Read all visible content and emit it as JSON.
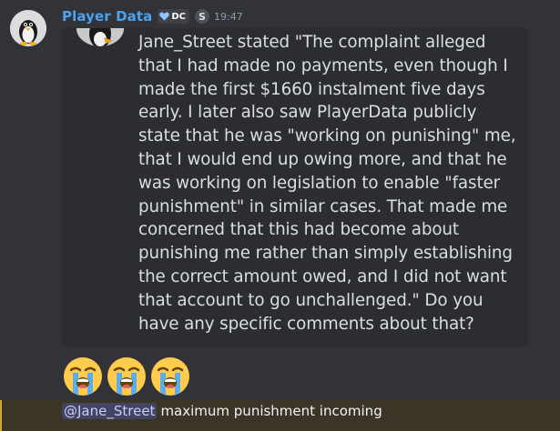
{
  "message": {
    "username": "Player Data",
    "tag": "DC",
    "badge": "S",
    "timestamp": "19:47",
    "quote": "Jane_Street stated \"The complaint alleged that I had made no payments, even though I made the first $1660 instalment five days early. I later also saw PlayerData publicly state that he was \"working on punishing\" me, that I would end up owing more, and that he was working on legislation to enable \"faster punishment\" in similar cases. That made me concerned that this had become about punishing me rather than simply establishing the correct amount owed, and I did not want that account to go unchallenged.\" Do you have any specific comments about that?"
  },
  "reactions": [
    "loudly-crying-face",
    "loudly-crying-face",
    "loudly-crying-face"
  ],
  "reply": {
    "mention": "@Jane_Street",
    "text": "maximum punishment incoming"
  },
  "colors": {
    "background": "#313338",
    "embed": "#2b2d31",
    "username": "#4aa3f0",
    "highlight": "#3a3526",
    "highlight_bar": "#d6a72f",
    "mention": "#5865f2"
  }
}
